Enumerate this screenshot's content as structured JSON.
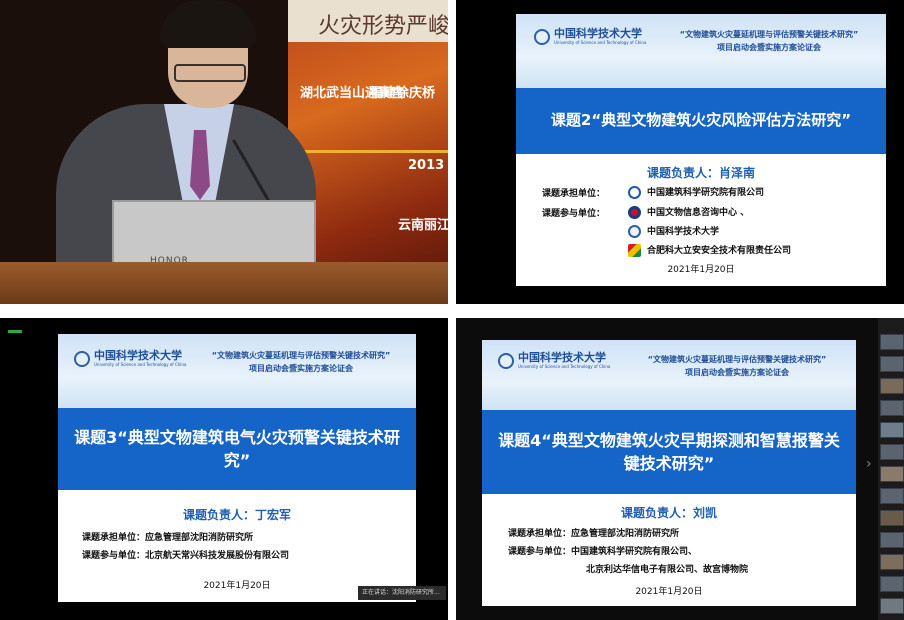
{
  "photo": {
    "screen_title": "火灾形势严峻",
    "screen_labels": [
      "湖北武当山遇真宫",
      "福建徐庆桥",
      "2013",
      "云南丽江古城"
    ],
    "laptop_brand": "HONOR"
  },
  "common": {
    "university_cn": "中国科学技术大学",
    "university_en": "University of Science and Technology of China",
    "meeting_line1": "“文物建筑火灾蔓延机理与评估预警关键技术研究”",
    "meeting_line2": "项目启动会暨实施方案论证会",
    "date": "2021年1月20日"
  },
  "slide2": {
    "topic": "课题2“典型文物建筑火灾风险评估方法研究”",
    "leader": "课题负责人：肖泽南",
    "undertaker_label": "课题承担单位：",
    "undertaker": "中国建筑科学研究院有限公司",
    "participant_label": "课题参与单位：",
    "participants": [
      "中国文物信息咨询中心 、",
      "中国科学技术大学",
      "合肥科大立安安全技术有限责任公司"
    ]
  },
  "slide3": {
    "topic": "课题3“典型文物建筑电气火灾预警关键技术研究”",
    "leader": "课题负责人：丁宏军",
    "undertaker_row": "课题承担单位：应急管理部沈阳消防研究所",
    "participant_row": "课题参与单位：北京航天常兴科技发展股份有限公司"
  },
  "slide4": {
    "topic": "课题4“典型文物建筑火灾早期探测和智慧报警关键技术研究”",
    "leader": "课题负责人：刘凯",
    "undertaker_row": "课题承担单位：应急管理部沈阳消防研究所",
    "participant_row": "课题参与单位：中国建筑科学研究院有限公司、",
    "participant_row2": "北京利达华信电子有限公司、故宫博物院"
  },
  "video_caption": "正在讲话：沈阳消防研究所..."
}
